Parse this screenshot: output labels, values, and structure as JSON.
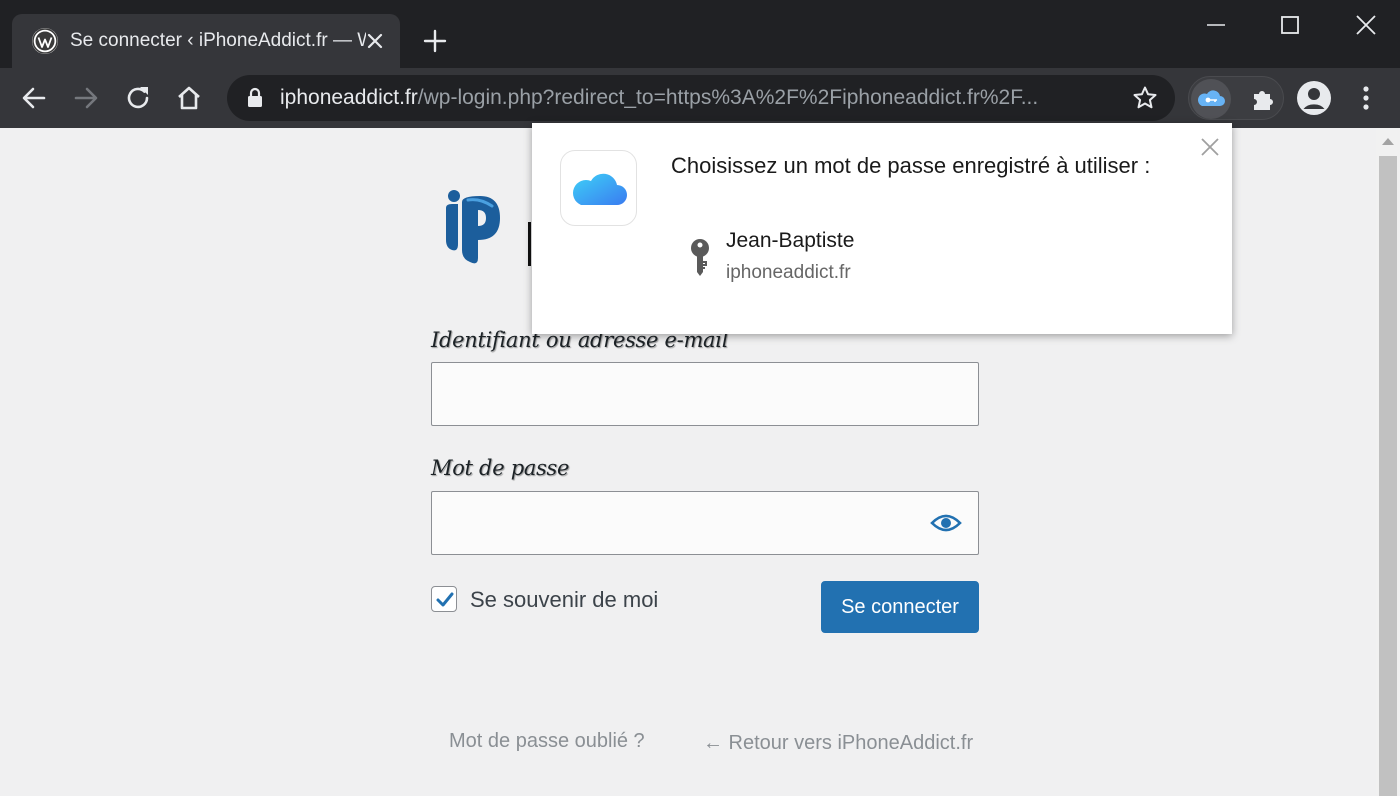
{
  "browser": {
    "tab_title": "Se connecter ‹ iPhoneAddict.fr — WordPress",
    "url_host": "iphoneaddict.fr",
    "url_path": "/wp-login.php?redirect_to=https%3A%2F%2Fiphoneaddict.fr%2F...",
    "icons": [
      "wordpress-icon",
      "close-icon",
      "plus-icon",
      "minimize-icon",
      "maximize-icon",
      "back-icon",
      "forward-icon",
      "reload-icon",
      "home-icon",
      "lock-icon",
      "star-icon",
      "icloud-key-icon",
      "puzzle-icon",
      "profile-icon",
      "kebab-menu-icon"
    ]
  },
  "login": {
    "user_label": "Identifiant ou adresse e-mail",
    "user_value": "",
    "pass_label": "Mot de passe",
    "pass_value": "",
    "remember_label": "Se souvenir de moi",
    "remember_checked": true,
    "submit_label": "Se connecter",
    "lost_password": "Mot de passe oublié ?",
    "back_link": "← Retour vers iPhoneAddict.fr"
  },
  "popup": {
    "title": "Choisissez un mot de passe enregistré à utiliser :",
    "credential_user": "Jean-Baptiste",
    "credential_site": "iphoneaddict.fr"
  },
  "colors": {
    "chrome_dark": "#202124",
    "chrome_toolbar": "#35363a",
    "wp_blue": "#2271b1",
    "page_bg": "#f0f0f1"
  }
}
